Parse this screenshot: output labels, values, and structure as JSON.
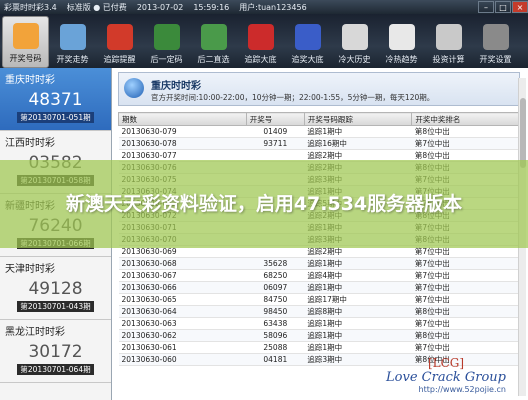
{
  "titlebar": {
    "app_name": "彩票时时彩3.4",
    "version": "标准版 ● 已付费",
    "date": "2013-07-02",
    "time": "15:59:16",
    "user": "用户:tuan123456"
  },
  "toolbar": [
    {
      "label": "开奖号码",
      "icon": "clock-icon",
      "color": "#f2a33a"
    },
    {
      "label": "开奖走势",
      "icon": "chart-icon",
      "color": "#6aa3d8"
    },
    {
      "label": "追踪提醒",
      "icon": "alarm-icon",
      "color": "#d23a2a"
    },
    {
      "label": "后一定码",
      "icon": "digit-icon",
      "color": "#3b8a3b"
    },
    {
      "label": "后二直选",
      "icon": "pen-icon",
      "color": "#4a9a4a"
    },
    {
      "label": "追踪大底",
      "icon": "ball-icon",
      "color": "#cc2b2b"
    },
    {
      "label": "追奖大底",
      "icon": "tag-icon",
      "color": "#3a5dc8"
    },
    {
      "label": "冷大历史",
      "icon": "cube-icon",
      "color": "#d8d8d8"
    },
    {
      "label": "冷热趋势",
      "icon": "trend-icon",
      "color": "#e8e8e8"
    },
    {
      "label": "投资计算",
      "icon": "calc-icon",
      "color": "#c9c9c9"
    },
    {
      "label": "开奖设置",
      "icon": "settings-icon",
      "color": "#8a8a8a"
    }
  ],
  "sidebar": [
    {
      "name": "重庆时时彩",
      "number": "48371",
      "issue": "第20130701-051期"
    },
    {
      "name": "江西时时彩",
      "number": "03582",
      "issue": "第20130701-058期"
    },
    {
      "name": "新疆时时彩",
      "number": "76240",
      "issue": "第20130701-066期"
    },
    {
      "name": "天津时时彩",
      "number": "49128",
      "issue": "第20130701-043期"
    },
    {
      "name": "黑龙江时时彩",
      "number": "30172",
      "issue": "第20130701-064期"
    }
  ],
  "main": {
    "title": "重庆时时彩",
    "desc": "官方开奖时间:10:00-22:00，10分钟一期；22:00-1:55，5分钟一期，每天120期。",
    "columns": [
      "期数",
      "开奖号",
      "开奖号码跟踪",
      "开奖中奖排名"
    ],
    "rows": [
      [
        "20130630-079",
        "01409",
        "追踪1期中",
        "第8位中出"
      ],
      [
        "20130630-078",
        "93711",
        "追踪16期中",
        "第7位中出"
      ],
      [
        "20130630-077",
        "",
        "追踪2期中",
        "第8位中出"
      ],
      [
        "20130630-076",
        "",
        "追踪2期中",
        "第8位中出"
      ],
      [
        "20130630-075",
        "",
        "追踪3期中",
        "第7位中出"
      ],
      [
        "20130630-074",
        "",
        "追踪1期中",
        "第7位中出"
      ],
      [
        "20130630-073",
        "",
        "追踪5期中",
        "第7位中出"
      ],
      [
        "20130630-072",
        "",
        "追踪2期中",
        "第8位中出"
      ],
      [
        "20130630-071",
        "",
        "追踪1期中",
        "第7位中出"
      ],
      [
        "20130630-070",
        "",
        "追踪3期中",
        "第8位中出"
      ],
      [
        "20130630-069",
        "",
        "追踪2期中",
        "第7位中出"
      ],
      [
        "20130630-068",
        "35628",
        "追踪1期中",
        "第7位中出"
      ],
      [
        "20130630-067",
        "68250",
        "追踪4期中",
        "第7位中出"
      ],
      [
        "20130630-066",
        "06097",
        "追踪1期中",
        "第7位中出"
      ],
      [
        "20130630-065",
        "84750",
        "追踪17期中",
        "第7位中出"
      ],
      [
        "20130630-064",
        "98450",
        "追踪8期中",
        "第8位中出"
      ],
      [
        "20130630-063",
        "63438",
        "追踪1期中",
        "第7位中出"
      ],
      [
        "20130630-062",
        "58096",
        "追踪1期中",
        "第8位中出"
      ],
      [
        "20130630-061",
        "25088",
        "追踪1期中",
        "第7位中出"
      ],
      [
        "20130630-060",
        "04181",
        "追踪3期中",
        "第8位中出"
      ]
    ]
  },
  "overlay": {
    "text": "新澳天天彩资料验证，启用47.534服务器版本"
  },
  "watermark": {
    "tag": "[LCG]",
    "name": "Love Crack Group",
    "url": "http://www.52pojie.cn"
  }
}
